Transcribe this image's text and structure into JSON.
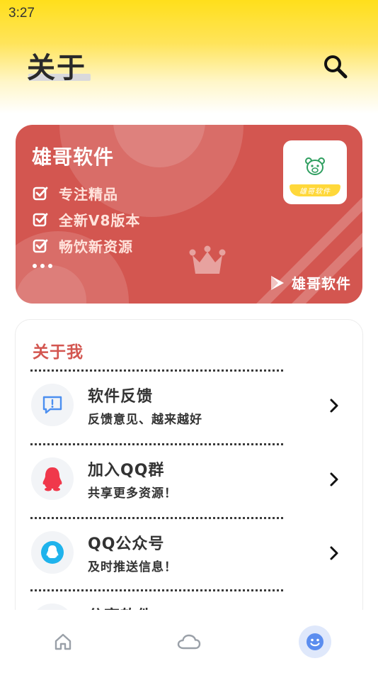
{
  "status_bar": {
    "time": "3:27"
  },
  "header": {
    "title": "关于",
    "search_icon": "search-icon"
  },
  "hero": {
    "app_name": "雄哥软件",
    "features": [
      "专注精品",
      "全新V8版本",
      "畅饮新资源"
    ],
    "logo_text": "雄哥软件",
    "store_label": "雄哥软件",
    "card_color": "#d35650"
  },
  "about": {
    "heading": "关于我",
    "items": [
      {
        "title": "软件反馈",
        "subtitle": "反馈意见、越来越好",
        "icon": "feedback-chat-icon"
      },
      {
        "title": "加入QQ群",
        "subtitle": "共享更多资源！",
        "icon": "qq-penguin-icon"
      },
      {
        "title": "QQ公众号",
        "subtitle": "及时推送信息！",
        "icon": "qq-official-account-icon"
      },
      {
        "title": "分享软件",
        "subtitle": "",
        "icon": "share-icon"
      }
    ]
  },
  "bottom_nav": {
    "items": [
      {
        "name": "home",
        "icon": "home-icon",
        "active": false
      },
      {
        "name": "cloud",
        "icon": "cloud-icon",
        "active": false
      },
      {
        "name": "me",
        "icon": "smiley-face-icon",
        "active": true
      }
    ]
  },
  "colors": {
    "accent_yellow": "#ffdf1b",
    "accent_red": "#d35650",
    "nav_active": "#5b8def"
  }
}
